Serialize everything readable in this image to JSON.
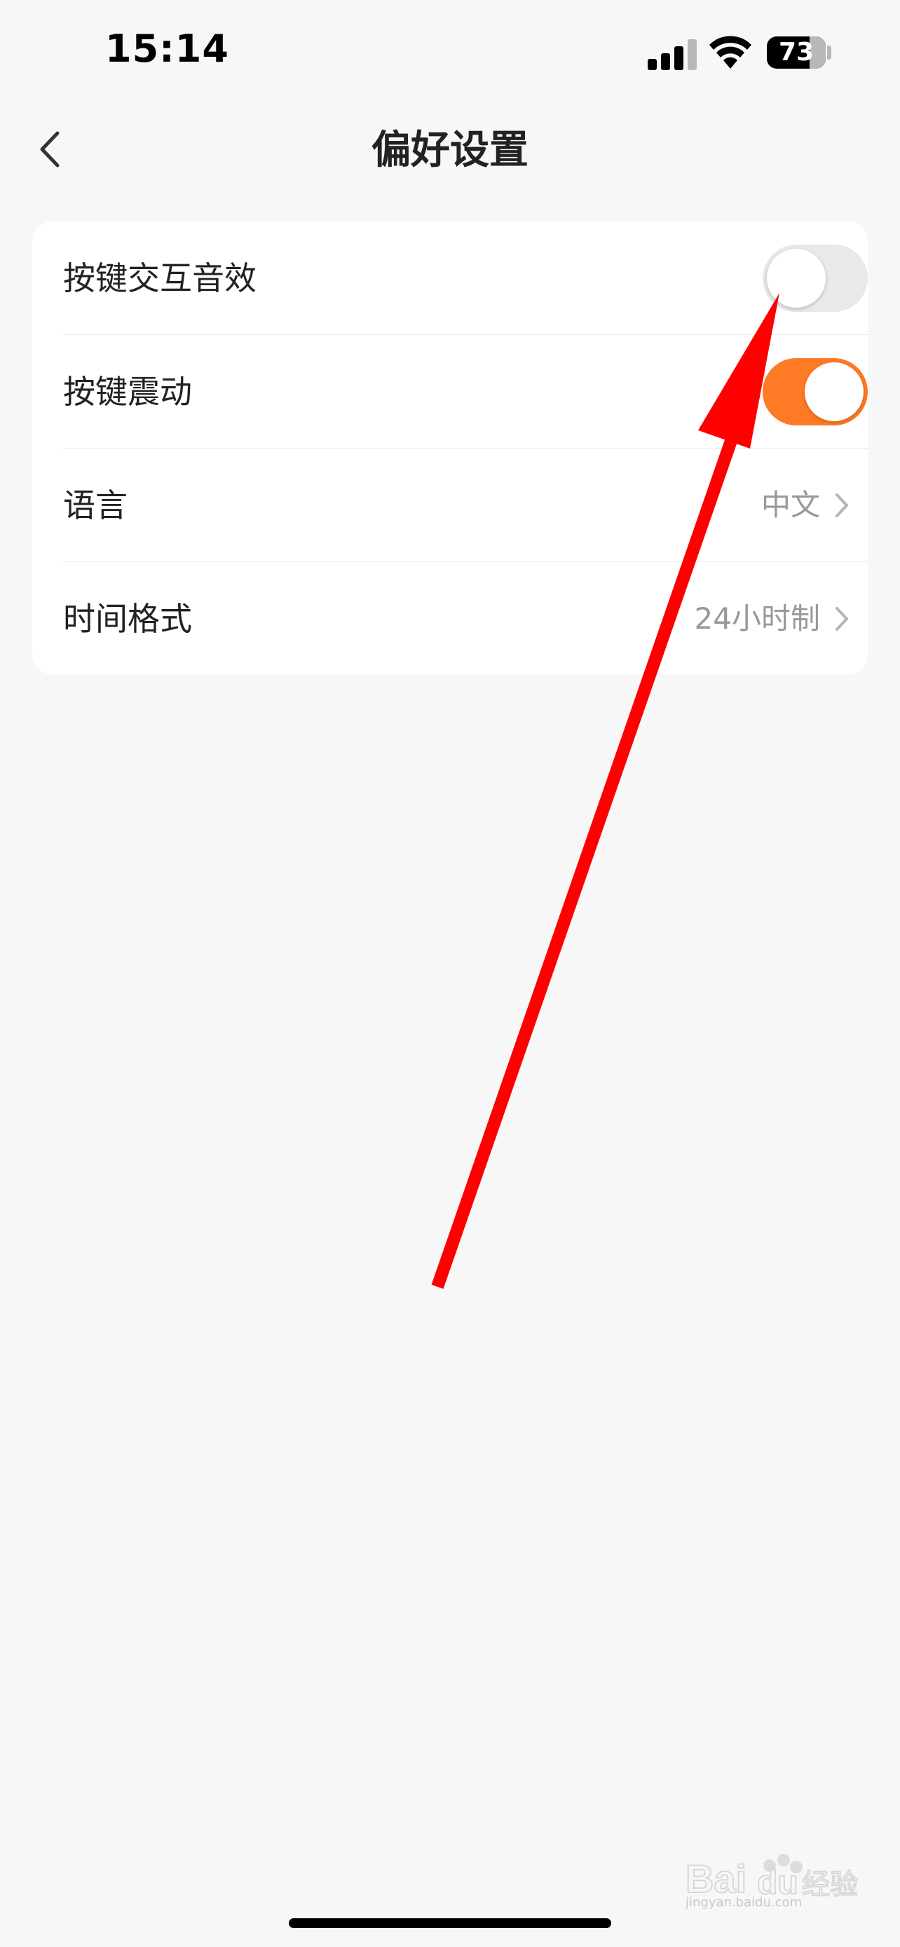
{
  "status_bar": {
    "time": "15:14",
    "battery_level": "73",
    "battery_fraction": 0.73,
    "signal_icon": "cellular-signal-icon",
    "wifi_icon": "wifi-icon"
  },
  "nav": {
    "title": "偏好设置",
    "back_icon": "chevron-left-icon"
  },
  "settings": {
    "rows": [
      {
        "label": "按键交互音效",
        "type": "toggle",
        "state": "off"
      },
      {
        "label": "按键震动",
        "type": "toggle",
        "state": "on"
      },
      {
        "label": "语言",
        "type": "value",
        "value": "中文"
      },
      {
        "label": "时间格式",
        "type": "value",
        "value": "24小时制"
      }
    ]
  },
  "colors": {
    "accent": "#ff7a24",
    "annotation_arrow": "#ff0000",
    "background": "#f7f7f7"
  },
  "watermark": {
    "text": "Baidu 经验",
    "subtext": "jingyan.baidu.com"
  }
}
